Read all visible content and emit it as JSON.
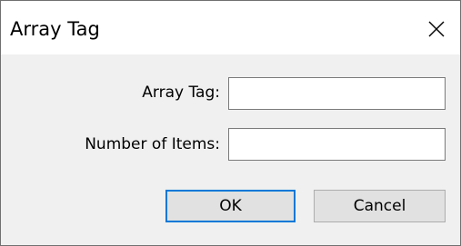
{
  "window": {
    "title": "Array Tag",
    "close_icon": "close-icon"
  },
  "form": {
    "array_tag_label": "Array Tag:",
    "array_tag_value": "",
    "number_of_items_label": "Number of Items:",
    "number_of_items_value": ""
  },
  "buttons": {
    "ok_label": "OK",
    "cancel_label": "Cancel"
  },
  "colors": {
    "accent": "#0078d7",
    "dialog_bg": "#f0f0f0",
    "titlebar_bg": "#ffffff"
  }
}
